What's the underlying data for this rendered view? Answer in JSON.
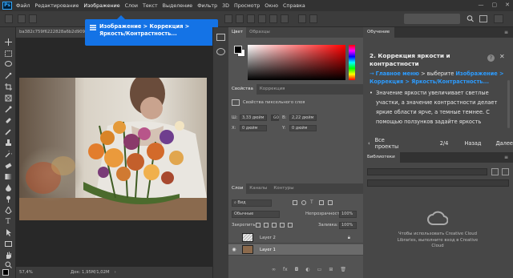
{
  "app": {
    "logo": "Ps"
  },
  "menubar": {
    "items": [
      "Файл",
      "Редактирование",
      "Изображение",
      "Слои",
      "Текст",
      "Выделение",
      "Фильтр",
      "3D",
      "Просмотр",
      "Окно",
      "Справка"
    ]
  },
  "doc": {
    "tab_title": "ba382c759f6222828a6b2d909.jpg",
    "zoom": "57,4%",
    "doc_size": "Док: 1,95M/1,02M"
  },
  "tooltip": {
    "text": "Изображение > Коррекция > Яркость/Контрастность..."
  },
  "color_panel": {
    "tabs": [
      "Цвет",
      "Образцы"
    ]
  },
  "properties_panel": {
    "tabs": [
      "Свойства",
      "Коррекция"
    ],
    "heading": "Свойства пиксельного слоя",
    "w_label": "Ш:",
    "w_value": "3,33 дюйм",
    "h_label": "В:",
    "h_value": "2,22 дюйм",
    "link": "GO",
    "x_label": "X:",
    "x_value": "0 дюйм",
    "y_label": "Y:",
    "y_value": "0 дюйм"
  },
  "layers_panel": {
    "tabs": [
      "Слои",
      "Каналы",
      "Контуры"
    ],
    "filter": "Вид",
    "blend_mode": "Обычные",
    "opacity_label": "Непрозрачность:",
    "opacity_value": "100%",
    "lock_label": "Закрепить:",
    "fill_label": "Заливка:",
    "fill_value": "100%",
    "layers": [
      {
        "name": "Layer 2",
        "visible": false,
        "selected": false
      },
      {
        "name": "Layer 1",
        "visible": true,
        "selected": true
      }
    ]
  },
  "learn_panel": {
    "tab": "Обучение",
    "step_number": "2.",
    "step_title": "Коррекция яркости и контрастности",
    "path_prefix": "Главное меню",
    "path_middle": " > выберите ",
    "path_link": "Изображение > Коррекция > Яркость/Контрастность...",
    "description": "Значение яркости увеличивает светлые участки, а значение контрастности делает яркие области ярче, а темные темнее. С помощью ползунков задайте яркость",
    "all_projects": "Все проекты",
    "progress": "2/4",
    "back": "Назад",
    "next": "Далее",
    "accent": "#2d9cff"
  },
  "libraries_panel": {
    "tab": "Библиотеки",
    "message": "Чтобы использовать Creative Cloud Libraries, выполните вход в Creative Cloud"
  }
}
